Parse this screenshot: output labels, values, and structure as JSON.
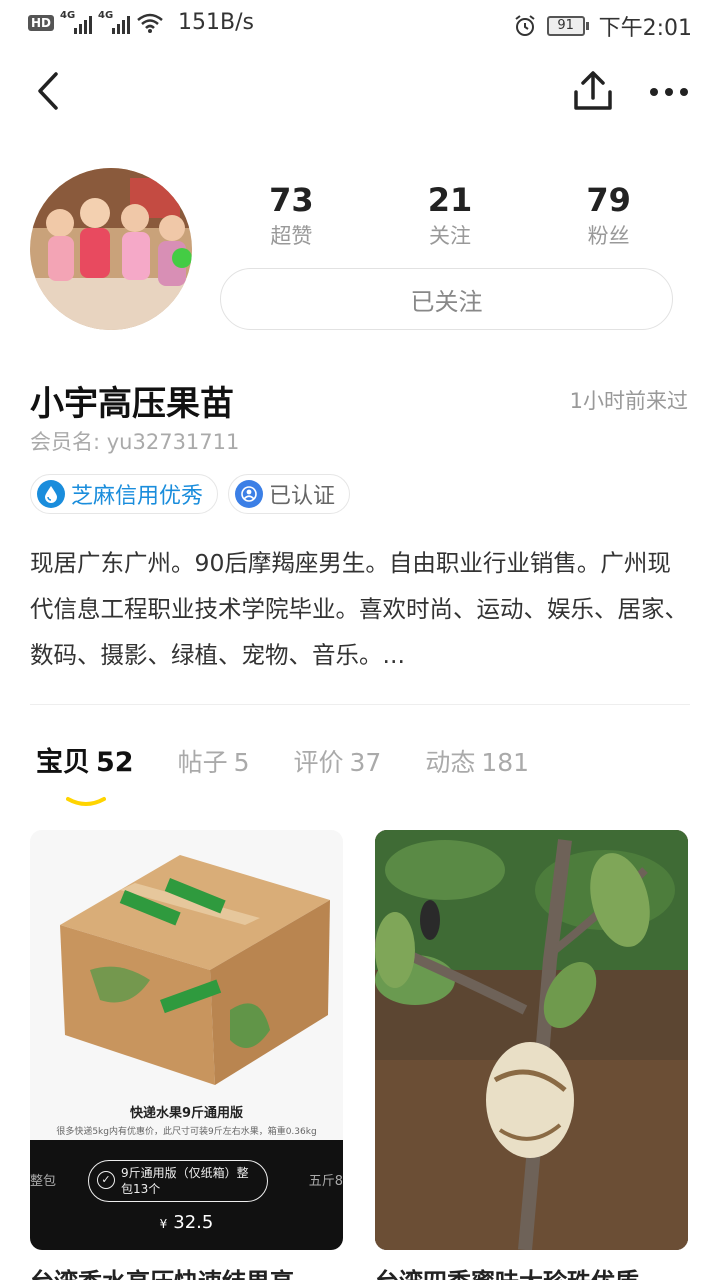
{
  "status_bar": {
    "hd": "HD",
    "net_speed": "151B/s",
    "battery": "91",
    "time": "下午2:01"
  },
  "nav": {
    "back_icon": "chevron-left-icon",
    "share_icon": "share-icon",
    "more_icon": "more-horizontal-icon"
  },
  "profile": {
    "stats": [
      {
        "value": "73",
        "label": "超赞"
      },
      {
        "value": "21",
        "label": "关注"
      },
      {
        "value": "79",
        "label": "粉丝"
      }
    ],
    "follow_label": "已关注",
    "name": "小宇高压果苗",
    "last_seen": "1小时前来过",
    "member": "会员名: yu32731711",
    "badges": {
      "sesame": "芝麻信用优秀",
      "verified": "已认证"
    },
    "bio": "现居广东广州。90后摩羯座男生。自由职业行业销售。广州现代信息工程职业技术学院毕业。喜欢时尚、运动、娱乐、居家、数码、摄影、绿植、宠物、音乐。..."
  },
  "tabs": [
    {
      "label": "宝贝",
      "count": "52",
      "active": true
    },
    {
      "label": "帖子",
      "count": "5",
      "active": false
    },
    {
      "label": "评价",
      "count": "37",
      "active": false
    },
    {
      "label": "动态",
      "count": "181",
      "active": false
    }
  ],
  "items": [
    {
      "caption": "快递水果9斤通用版",
      "subcaption": "很多快递5kg内有优惠价，此尺寸可装9斤左右水果，箱重0.36kg",
      "left_edge": "整包",
      "right_edge": "五斤8",
      "option": "9斤通用版（仅纸箱）整包13个",
      "price_symbol": "¥",
      "price": "32.5",
      "title": "台湾香水高压快速结果高"
    },
    {
      "title": "台湾四季蜜味大珍珠优质"
    }
  ],
  "colors": {
    "accent_yellow": "#ffd400",
    "sesame_blue": "#1a8ddc"
  }
}
